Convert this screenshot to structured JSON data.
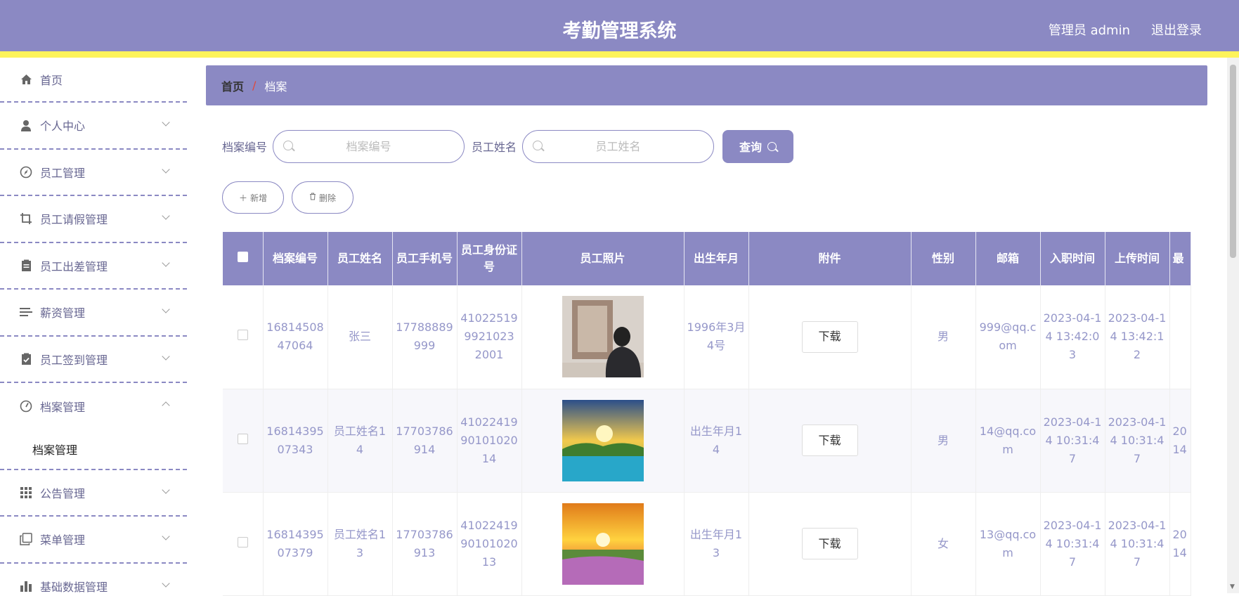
{
  "header": {
    "title": "考勤管理系统",
    "user": "管理员 admin",
    "logout": "退出登录"
  },
  "sidebar": {
    "items": [
      {
        "label": "首页",
        "icon": "home-icon"
      },
      {
        "label": "个人中心",
        "icon": "user-icon"
      },
      {
        "label": "员工管理",
        "icon": "compass-icon"
      },
      {
        "label": "员工请假管理",
        "icon": "crop-icon"
      },
      {
        "label": "员工出差管理",
        "icon": "clipboard-icon"
      },
      {
        "label": "薪资管理",
        "icon": "list-icon"
      },
      {
        "label": "员工签到管理",
        "icon": "checklist-icon"
      },
      {
        "label": "档案管理",
        "icon": "gauge-icon",
        "sub": "档案管理"
      },
      {
        "label": "公告管理",
        "icon": "grid-icon"
      },
      {
        "label": "菜单管理",
        "icon": "copy-icon"
      },
      {
        "label": "基础数据管理",
        "icon": "bar-chart-icon"
      }
    ]
  },
  "breadcrumb": {
    "home": "首页",
    "sep": "/",
    "current": "档案"
  },
  "search": {
    "label1": "档案编号",
    "placeholder1": "档案编号",
    "label2": "员工姓名",
    "placeholder2": "员工姓名",
    "query": "查询"
  },
  "actions": {
    "add": "新增",
    "delete": "删除"
  },
  "table": {
    "headers": [
      "档案编号",
      "员工姓名",
      "员工手机号",
      "员工身份证号",
      "员工照片",
      "出生年月",
      "附件",
      "性别",
      "邮箱",
      "入职时间",
      "上传时间",
      "最"
    ],
    "download_label": "下载",
    "rows": [
      {
        "id": "1681450847064",
        "name": "张三",
        "phone": "17788889999",
        "idcard": "410225199921023 2001",
        "birth": "1996年3月4号",
        "gender": "男",
        "email": "999@qq.com",
        "join": "2023-04-14 13:42:03",
        "upload": "2023-04-14 13:42:12",
        "last": ""
      },
      {
        "id": "1681439507343",
        "name": "员工姓名14",
        "phone": "17703786914",
        "idcard": "4102241990101020 14",
        "birth": "出生年月14",
        "gender": "男",
        "email": "14@qq.com",
        "join": "2023-04-14 10:31:47",
        "upload": "2023-04-14 10:31:47",
        "last": "2014"
      },
      {
        "id": "1681439507379",
        "name": "员工姓名13",
        "phone": "17703786913",
        "idcard": "4102241990101020 13",
        "birth": "出生年月13",
        "gender": "女",
        "email": "13@qq.com",
        "join": "2023-04-14 10:31:47",
        "upload": "2023-04-14 10:31:47",
        "last": "2014"
      }
    ]
  }
}
